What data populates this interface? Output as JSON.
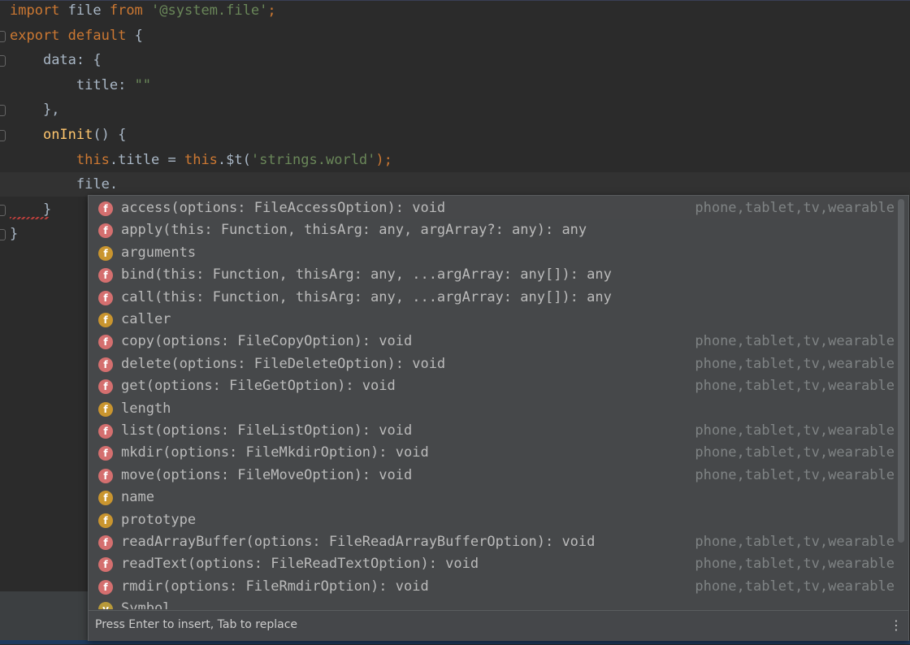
{
  "editor": {
    "lines": [
      {
        "tokens": [
          {
            "t": "import",
            "c": "kw"
          },
          {
            "t": " file ",
            "c": "plain"
          },
          {
            "t": "from",
            "c": "kw"
          },
          {
            "t": " ",
            "c": "plain"
          },
          {
            "t": "'@system.file'",
            "c": "str"
          },
          {
            "t": ";",
            "c": "kw"
          }
        ]
      },
      {
        "tokens": [
          {
            "t": "export",
            "c": "kw"
          },
          {
            "t": " ",
            "c": "plain"
          },
          {
            "t": "default",
            "c": "kw"
          },
          {
            "t": " {",
            "c": "plain"
          }
        ]
      },
      {
        "tokens": [
          {
            "t": "    ",
            "c": "plain"
          },
          {
            "t": "data",
            "c": "plain"
          },
          {
            "t": ": {",
            "c": "plain"
          }
        ]
      },
      {
        "tokens": [
          {
            "t": "        ",
            "c": "plain"
          },
          {
            "t": "title",
            "c": "plain"
          },
          {
            "t": ": ",
            "c": "plain"
          },
          {
            "t": "\"\"",
            "c": "str"
          }
        ]
      },
      {
        "tokens": [
          {
            "t": "    ",
            "c": "plain"
          },
          {
            "t": "},",
            "c": "plain"
          }
        ]
      },
      {
        "tokens": [
          {
            "t": "    ",
            "c": "plain"
          },
          {
            "t": "onInit",
            "c": "fn"
          },
          {
            "t": "() {",
            "c": "plain"
          }
        ]
      },
      {
        "tokens": [
          {
            "t": "        ",
            "c": "plain"
          },
          {
            "t": "this",
            "c": "kw"
          },
          {
            "t": ".title = ",
            "c": "plain"
          },
          {
            "t": "this",
            "c": "kw"
          },
          {
            "t": ".$t(",
            "c": "plain"
          },
          {
            "t": "'strings.world'",
            "c": "str"
          },
          {
            "t": ");",
            "c": "kw"
          }
        ]
      },
      {
        "tokens": [
          {
            "t": "        ",
            "c": "plain"
          },
          {
            "t": "file.",
            "c": "plain"
          }
        ]
      },
      {
        "tokens": [
          {
            "t": "    ",
            "c": "plain"
          },
          {
            "t": "}",
            "c": "plain"
          }
        ]
      },
      {
        "tokens": [
          {
            "t": "}",
            "c": "plain"
          }
        ]
      }
    ]
  },
  "completion": {
    "items": [
      {
        "kind": "method",
        "badge": "f",
        "signature": "access(options: FileAccessOption): void",
        "tail": "phone,tablet,tv,wearable"
      },
      {
        "kind": "method",
        "badge": "f",
        "signature": "apply(this: Function, thisArg: any, argArray?: any): any",
        "tail": ""
      },
      {
        "kind": "property",
        "badge": "f",
        "signature": "arguments",
        "tail": ""
      },
      {
        "kind": "method",
        "badge": "f",
        "signature": "bind(this: Function, thisArg: any, ...argArray: any[]): any",
        "tail": ""
      },
      {
        "kind": "method",
        "badge": "f",
        "signature": "call(this: Function, thisArg: any, ...argArray: any[]): any",
        "tail": ""
      },
      {
        "kind": "property",
        "badge": "f",
        "signature": "caller",
        "tail": ""
      },
      {
        "kind": "method",
        "badge": "f",
        "signature": "copy(options: FileCopyOption): void",
        "tail": "phone,tablet,tv,wearable"
      },
      {
        "kind": "method",
        "badge": "f",
        "signature": "delete(options: FileDeleteOption): void",
        "tail": "phone,tablet,tv,wearable"
      },
      {
        "kind": "method",
        "badge": "f",
        "signature": "get(options: FileGetOption): void",
        "tail": "phone,tablet,tv,wearable"
      },
      {
        "kind": "property",
        "badge": "f",
        "signature": "length",
        "tail": ""
      },
      {
        "kind": "method",
        "badge": "f",
        "signature": "list(options: FileListOption): void",
        "tail": "phone,tablet,tv,wearable"
      },
      {
        "kind": "method",
        "badge": "f",
        "signature": "mkdir(options: FileMkdirOption): void",
        "tail": "phone,tablet,tv,wearable"
      },
      {
        "kind": "method",
        "badge": "f",
        "signature": "move(options: FileMoveOption): void",
        "tail": "phone,tablet,tv,wearable"
      },
      {
        "kind": "property",
        "badge": "f",
        "signature": "name",
        "tail": ""
      },
      {
        "kind": "property",
        "badge": "f",
        "signature": "prototype",
        "tail": ""
      },
      {
        "kind": "method",
        "badge": "f",
        "signature": "readArrayBuffer(options: FileReadArrayBufferOption): void",
        "tail": "phone,tablet,tv,wearable"
      },
      {
        "kind": "method",
        "badge": "f",
        "signature": "readText(options: FileReadTextOption): void",
        "tail": "phone,tablet,tv,wearable"
      },
      {
        "kind": "method",
        "badge": "f",
        "signature": "rmdir(options: FileRmdirOption): void",
        "tail": "phone,tablet,tv,wearable"
      },
      {
        "kind": "variable",
        "badge": "v",
        "signature": "Symbol",
        "tail": ""
      }
    ],
    "footer_hint": "Press Enter to insert, Tab to replace",
    "menu_icon": "vertical-dots-icon"
  }
}
